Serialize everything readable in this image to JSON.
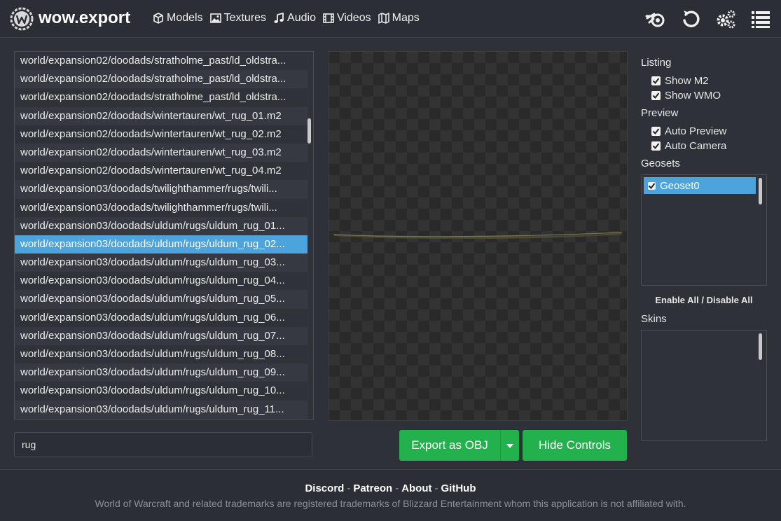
{
  "header": {
    "title": "wow.export",
    "nav": [
      {
        "label": "Models",
        "icon": "cube-icon"
      },
      {
        "label": "Textures",
        "icon": "image-icon"
      },
      {
        "label": "Audio",
        "icon": "music-icon"
      },
      {
        "label": "Videos",
        "icon": "film-icon"
      },
      {
        "label": "Maps",
        "icon": "map-icon"
      }
    ],
    "right_icons": [
      "blender-icon",
      "reload-icon",
      "settings-icon",
      "menu-icon"
    ]
  },
  "file_list": {
    "selected_index": 10,
    "items": [
      "world/expansion02/doodads/stratholme_past/ld_oldstra...",
      "world/expansion02/doodads/stratholme_past/ld_oldstra...",
      "world/expansion02/doodads/stratholme_past/ld_oldstra...",
      "world/expansion02/doodads/wintertauren/wt_rug_01.m2",
      "world/expansion02/doodads/wintertauren/wt_rug_02.m2",
      "world/expansion02/doodads/wintertauren/wt_rug_03.m2",
      "world/expansion02/doodads/wintertauren/wt_rug_04.m2",
      "world/expansion03/doodads/twilighthammer/rugs/twili...",
      "world/expansion03/doodads/twilighthammer/rugs/twili...",
      "world/expansion03/doodads/uldum/rugs/uldum_rug_01...",
      "world/expansion03/doodads/uldum/rugs/uldum_rug_02...",
      "world/expansion03/doodads/uldum/rugs/uldum_rug_03...",
      "world/expansion03/doodads/uldum/rugs/uldum_rug_04...",
      "world/expansion03/doodads/uldum/rugs/uldum_rug_05...",
      "world/expansion03/doodads/uldum/rugs/uldum_rug_06...",
      "world/expansion03/doodads/uldum/rugs/uldum_rug_07...",
      "world/expansion03/doodads/uldum/rugs/uldum_rug_08...",
      "world/expansion03/doodads/uldum/rugs/uldum_rug_09...",
      "world/expansion03/doodads/uldum/rugs/uldum_rug_10...",
      "world/expansion03/doodads/uldum/rugs/uldum_rug_11..."
    ]
  },
  "search": {
    "value": "rug"
  },
  "actions": {
    "export_label": "Export as OBJ",
    "hide_controls_label": "Hide Controls"
  },
  "sidebar": {
    "listing_title": "Listing",
    "show_m2": "Show M2",
    "show_wmo": "Show WMO",
    "preview_title": "Preview",
    "auto_preview": "Auto Preview",
    "auto_camera": "Auto Camera",
    "geosets_title": "Geosets",
    "geosets": [
      {
        "label": "Geoset0",
        "checked": true
      }
    ],
    "enable_all": "Enable All",
    "separator": "/",
    "disable_all": "Disable All",
    "skins_title": "Skins"
  },
  "footer": {
    "links": [
      "Discord",
      "Patreon",
      "About",
      "GitHub"
    ],
    "separator": "-",
    "note": "World of Warcraft and related trademarks are registered trademarks of Blizzard Entertainment whom this application is not affiliated with."
  },
  "colors": {
    "accent_green": "#22b14c",
    "selection_blue": "#4da3dc",
    "background": "#2e3138"
  }
}
